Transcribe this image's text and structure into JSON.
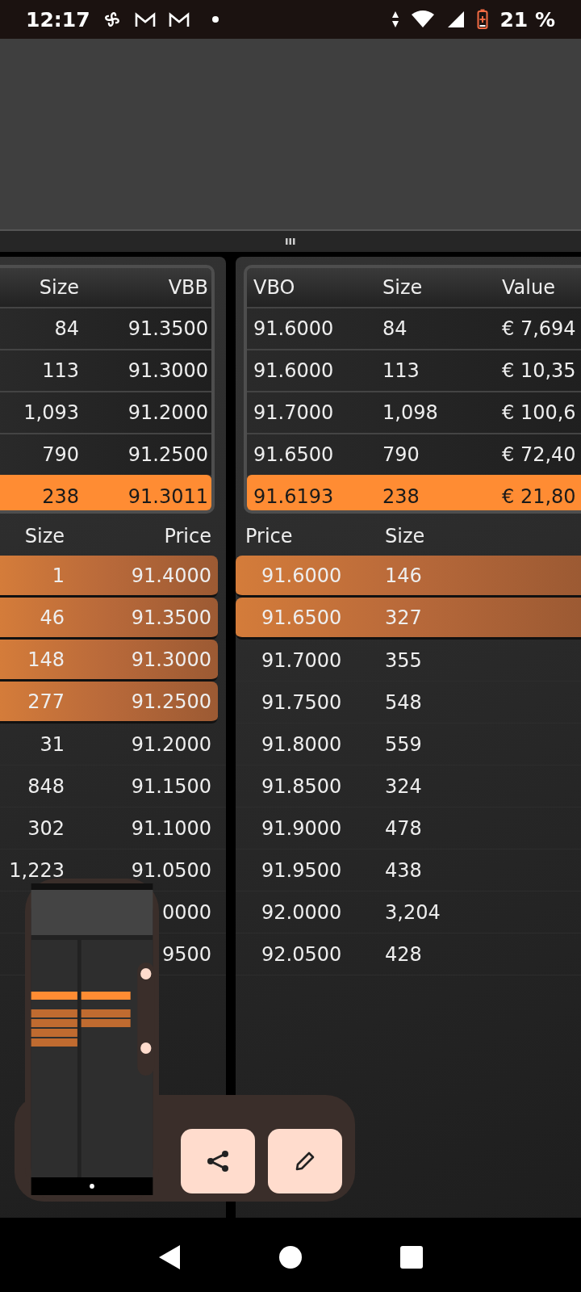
{
  "status_bar": {
    "time": "12:17",
    "battery": "21 %"
  },
  "bid_summary": {
    "columns": [
      "Size",
      "VBB"
    ],
    "rows": [
      {
        "size": "84",
        "vbb": "91.3500",
        "highlighted": false
      },
      {
        "size": "113",
        "vbb": "91.3000",
        "highlighted": false
      },
      {
        "size": "1,093",
        "vbb": "91.2000",
        "highlighted": false
      },
      {
        "size": "790",
        "vbb": "91.2500",
        "highlighted": false
      },
      {
        "size": "238",
        "vbb": "91.3011",
        "highlighted": true
      }
    ]
  },
  "offer_summary": {
    "columns": [
      "VBO",
      "Size",
      "Value"
    ],
    "rows": [
      {
        "vbo": "91.6000",
        "size": "84",
        "value": "€ 7,694",
        "highlighted": false
      },
      {
        "vbo": "91.6000",
        "size": "113",
        "value": "€ 10,35",
        "highlighted": false
      },
      {
        "vbo": "91.7000",
        "size": "1,098",
        "value": "€ 100,6",
        "highlighted": false
      },
      {
        "vbo": "91.6500",
        "size": "790",
        "value": "€ 72,40",
        "highlighted": false
      },
      {
        "vbo": "91.6193",
        "size": "238",
        "value": "€ 21,80",
        "highlighted": true
      }
    ]
  },
  "bids": {
    "columns": [
      "Size",
      "Price"
    ],
    "rows": [
      {
        "size": "1",
        "price": "91.4000",
        "highlighted": true
      },
      {
        "size": "46",
        "price": "91.3500",
        "highlighted": true
      },
      {
        "size": "148",
        "price": "91.3000",
        "highlighted": true
      },
      {
        "size": "277",
        "price": "91.2500",
        "highlighted": true
      },
      {
        "size": "31",
        "price": "91.2000",
        "highlighted": false
      },
      {
        "size": "848",
        "price": "91.1500",
        "highlighted": false
      },
      {
        "size": "302",
        "price": "91.1000",
        "highlighted": false
      },
      {
        "size": "1,223",
        "price": "91.0500",
        "highlighted": false
      },
      {
        "price": "0000",
        "highlighted": false
      },
      {
        "price": "9500",
        "highlighted": false
      }
    ]
  },
  "offers": {
    "columns": [
      "Price",
      "Size"
    ],
    "rows": [
      {
        "price": "91.6000",
        "size": "146",
        "highlighted": true
      },
      {
        "price": "91.6500",
        "size": "327",
        "highlighted": true
      },
      {
        "price": "91.7000",
        "size": "355",
        "highlighted": false
      },
      {
        "price": "91.7500",
        "size": "548",
        "highlighted": false
      },
      {
        "price": "91.8000",
        "size": "559",
        "highlighted": false
      },
      {
        "price": "91.8500",
        "size": "324",
        "highlighted": false
      },
      {
        "price": "91.9000",
        "size": "478",
        "highlighted": false
      },
      {
        "price": "91.9500",
        "size": "438",
        "highlighted": false
      },
      {
        "price": "92.0000",
        "size": "3,204",
        "highlighted": false
      },
      {
        "price": "92.0500",
        "size": "428",
        "highlighted": false
      }
    ]
  }
}
